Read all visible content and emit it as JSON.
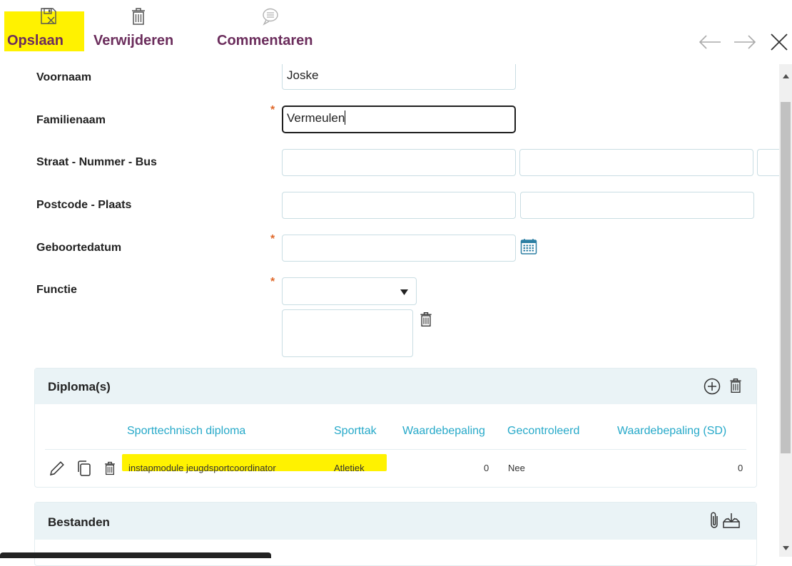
{
  "toolbar": {
    "save_label": "Opslaan",
    "delete_label": "Verwijderen",
    "comments_label": "Commentaren"
  },
  "form": {
    "voornaam": {
      "label": "Voornaam",
      "value": "Joske"
    },
    "familienaam": {
      "label": "Familienaam",
      "value": "Vermeulen",
      "required": "*"
    },
    "straat": {
      "label": "Straat - Nummer - Bus"
    },
    "postcode": {
      "label": "Postcode - Plaats"
    },
    "geboortedatum": {
      "label": "Geboortedatum",
      "required": "*"
    },
    "functie": {
      "label": "Functie",
      "required": "*"
    }
  },
  "diplomas": {
    "title": "Diploma(s)",
    "columns": [
      "Sporttechnisch diploma",
      "Sporttak",
      "Waardebepaling",
      "Gecontroleerd",
      "Waardebepaling (SD)"
    ],
    "rows": [
      {
        "diploma": "instapmodule jeugdsportcoordinator",
        "sporttak": "Atletiek",
        "waardebepaling": "0",
        "gecontroleerd": "Nee",
        "waardebepaling_sd": "0"
      }
    ]
  },
  "bestanden": {
    "title": "Bestanden"
  },
  "colors": {
    "accent": "#6b2d5c",
    "link": "#26a9c9",
    "required": "#e06a2c",
    "highlight": "#fff200"
  },
  "icons": [
    "save-icon",
    "trash-icon",
    "comment-icon",
    "arrow-left-icon",
    "arrow-right-icon",
    "close-icon",
    "calendar-icon",
    "add-circle-icon",
    "pencil-icon",
    "copy-icon",
    "paperclip-icon",
    "download-tray-icon"
  ]
}
